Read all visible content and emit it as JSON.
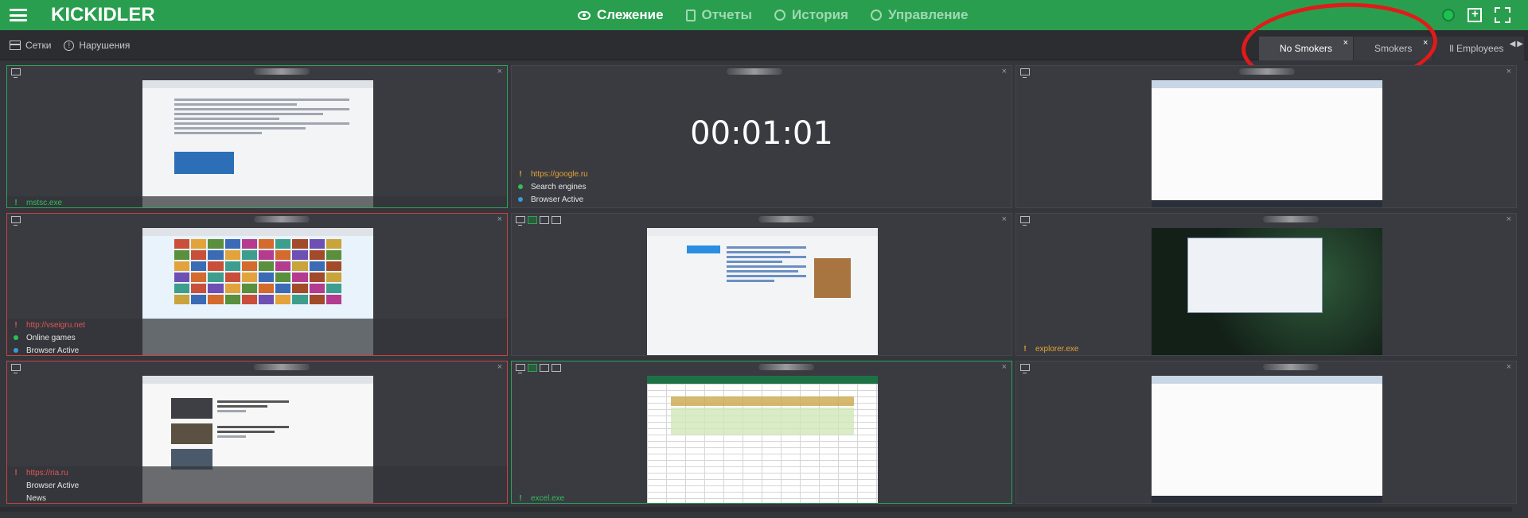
{
  "app": {
    "logo": "KICKIDLER"
  },
  "nav": [
    {
      "label": "Слежение",
      "icon": "eye-icon",
      "active": true
    },
    {
      "label": "Отчеты",
      "icon": "document-icon",
      "active": false
    },
    {
      "label": "История",
      "icon": "history-icon",
      "active": false
    },
    {
      "label": "Управление",
      "icon": "settings-icon",
      "active": false
    }
  ],
  "subbar": {
    "grids_label": "Сетки",
    "violations_label": "Нарушения"
  },
  "tabs": [
    {
      "label": "No Smokers",
      "close": "×",
      "active": true
    },
    {
      "label": "Smokers",
      "close": "×",
      "active": false
    },
    {
      "label": "ll Employees",
      "close": "",
      "active": false
    }
  ],
  "colors": {
    "accent_green": "#2a9e4f",
    "alert_red": "#c84343",
    "highlight_ring": "#e11a1a"
  },
  "cells": [
    {
      "id": "c1",
      "status": "green",
      "info": [
        {
          "type": "warn",
          "color": "green",
          "text": "mstsc.exe"
        }
      ]
    },
    {
      "id": "c2",
      "status": "none",
      "timer": "00:01:01",
      "info": [
        {
          "type": "warn",
          "color": "orange",
          "text": "https://google.ru"
        },
        {
          "type": "dot",
          "color": "green",
          "text": "Search engines"
        },
        {
          "type": "dot",
          "color": "blue",
          "text": "Browser Active"
        }
      ]
    },
    {
      "id": "c3",
      "status": "none",
      "info": []
    },
    {
      "id": "c4",
      "status": "red",
      "info": [
        {
          "type": "warn",
          "color": "red",
          "text": "http://vseigru.net"
        },
        {
          "type": "dot",
          "color": "green",
          "text": "Online games"
        },
        {
          "type": "dot",
          "color": "blue",
          "text": "Browser Active"
        }
      ]
    },
    {
      "id": "c5",
      "status": "none",
      "info": []
    },
    {
      "id": "c6",
      "status": "none",
      "info": [
        {
          "type": "warn",
          "color": "orange",
          "text": "explorer.exe"
        }
      ]
    },
    {
      "id": "c7",
      "status": "red",
      "info": [
        {
          "type": "warn",
          "color": "red",
          "text": "https://ria.ru"
        },
        {
          "type": "none",
          "color": "white",
          "text": "Browser Active"
        },
        {
          "type": "none",
          "color": "white",
          "text": "News"
        }
      ]
    },
    {
      "id": "c8",
      "status": "green",
      "info": [
        {
          "type": "warn",
          "color": "green",
          "text": "excel.exe"
        }
      ]
    },
    {
      "id": "c9",
      "status": "none",
      "info": []
    }
  ]
}
